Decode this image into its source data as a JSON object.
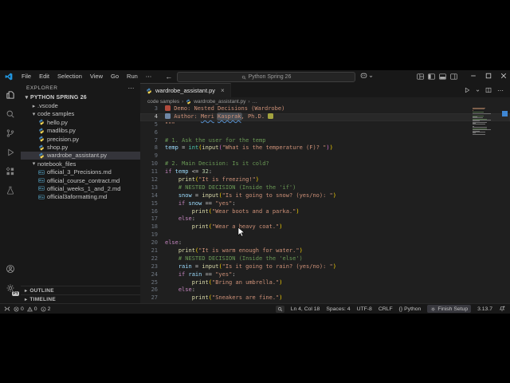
{
  "window": {
    "menus": [
      "File",
      "Edit",
      "Selection",
      "View",
      "Go",
      "Run",
      "⋯"
    ],
    "nav_back": "←",
    "nav_forward": "→",
    "search_text": "Python Spring 26"
  },
  "sidebar": {
    "header": "EXPLORER",
    "header_more": "⋯",
    "tree": [
      {
        "label": "PYTHON SPRING 26",
        "indent": 0,
        "chevron": "down",
        "root": true
      },
      {
        "label": ".vscode",
        "indent": 1,
        "chevron": "right"
      },
      {
        "label": "code samples",
        "indent": 1,
        "chevron": "down"
      },
      {
        "label": "hello.py",
        "indent": 2,
        "type": "py"
      },
      {
        "label": "madlibs.py",
        "indent": 2,
        "type": "py"
      },
      {
        "label": "precision.py",
        "indent": 2,
        "type": "py"
      },
      {
        "label": "shop.py",
        "indent": 2,
        "type": "py"
      },
      {
        "label": "wardrobe_assistant.py",
        "indent": 2,
        "type": "py",
        "selected": true
      },
      {
        "label": "notebook_files",
        "indent": 1,
        "chevron": "down"
      },
      {
        "label": "official_3_Precisions.md",
        "indent": 2,
        "type": "md"
      },
      {
        "label": "official_course_contract.md",
        "indent": 2,
        "type": "md"
      },
      {
        "label": "official_weeks_1_and_2.md",
        "indent": 2,
        "type": "md"
      },
      {
        "label": "official3aformatting.md",
        "indent": 2,
        "type": "md"
      }
    ],
    "sections": [
      {
        "label": "OUTLINE"
      },
      {
        "label": "TIMELINE"
      }
    ],
    "profile_badge": "PY"
  },
  "editor": {
    "tab": {
      "label": "wardrobe_assistant.py",
      "close": "×"
    },
    "breadcrumb": {
      "folder": "code samples",
      "file": "wardrobe_assistant.py",
      "symbol": "…",
      "sep": "›"
    },
    "current_line": 4,
    "lines": [
      {
        "n": 3,
        "seg": [
          [
            "e-coat",
            "🧥"
          ],
          [
            "d",
            " Demo: Nested Decisions (Wardrobe)"
          ]
        ]
      },
      {
        "n": 4,
        "seg": [
          [
            "e-person",
            "👤"
          ],
          [
            "d",
            " Author: "
          ],
          [
            "d sq",
            "Meri"
          ],
          [
            "d",
            " "
          ],
          [
            "d sq hl",
            "Kasprak"
          ],
          [
            "d",
            ", Ph.D. "
          ],
          [
            "e-glove",
            "🧤"
          ]
        ]
      },
      {
        "n": 5,
        "seg": [
          [
            "d",
            "\"\"\""
          ]
        ]
      },
      {
        "n": 6,
        "seg": []
      },
      {
        "n": 7,
        "seg": [
          [
            "c",
            "# 1. Ask the user for the temp"
          ]
        ]
      },
      {
        "n": 8,
        "seg": [
          [
            "v",
            "temp"
          ],
          [
            "o",
            " = "
          ],
          [
            "t",
            "int"
          ],
          [
            "p1",
            "("
          ],
          [
            "f",
            "input"
          ],
          [
            "p2",
            "("
          ],
          [
            "s",
            "\"What is the temperature (F)? \""
          ],
          [
            "p2",
            ")"
          ],
          [
            "p1",
            ")"
          ]
        ]
      },
      {
        "n": 9,
        "seg": []
      },
      {
        "n": 10,
        "seg": [
          [
            "c",
            "# 2. Main Decision: Is it cold?"
          ]
        ]
      },
      {
        "n": 11,
        "seg": [
          [
            "k",
            "if"
          ],
          [
            "o",
            " "
          ],
          [
            "v",
            "temp"
          ],
          [
            "o",
            " <= "
          ],
          [
            "n",
            "32"
          ],
          [
            "o",
            ":"
          ]
        ]
      },
      {
        "n": 12,
        "seg": [
          [
            "o",
            "    "
          ],
          [
            "f",
            "print"
          ],
          [
            "p1",
            "("
          ],
          [
            "s",
            "\"It is freezing!\""
          ],
          [
            "p1",
            ")"
          ]
        ]
      },
      {
        "n": 13,
        "seg": [
          [
            "c",
            "    # NESTED DECISION (Inside the 'if')"
          ]
        ]
      },
      {
        "n": 14,
        "seg": [
          [
            "o",
            "    "
          ],
          [
            "v",
            "snow"
          ],
          [
            "o",
            " = "
          ],
          [
            "f",
            "input"
          ],
          [
            "p1",
            "("
          ],
          [
            "s",
            "\"Is it going to snow? (yes/no): \""
          ],
          [
            "p1",
            ")"
          ]
        ]
      },
      {
        "n": 15,
        "seg": [
          [
            "o",
            "    "
          ],
          [
            "k",
            "if"
          ],
          [
            "o",
            " "
          ],
          [
            "v",
            "snow"
          ],
          [
            "o",
            " == "
          ],
          [
            "s",
            "\"yes\""
          ],
          [
            "o",
            ":"
          ]
        ]
      },
      {
        "n": 16,
        "seg": [
          [
            "o",
            "        "
          ],
          [
            "f",
            "print"
          ],
          [
            "p1",
            "("
          ],
          [
            "s",
            "\"Wear boots and a parka.\""
          ],
          [
            "p1",
            ")"
          ]
        ]
      },
      {
        "n": 17,
        "seg": [
          [
            "o",
            "    "
          ],
          [
            "k",
            "else"
          ],
          [
            "o",
            ":"
          ]
        ]
      },
      {
        "n": 18,
        "seg": [
          [
            "o",
            "        "
          ],
          [
            "f",
            "print"
          ],
          [
            "p1",
            "("
          ],
          [
            "s",
            "\"Wear a heavy coat.\""
          ],
          [
            "p1",
            ")"
          ]
        ]
      },
      {
        "n": 19,
        "seg": []
      },
      {
        "n": 20,
        "seg": [
          [
            "k",
            "else"
          ],
          [
            "o",
            ":"
          ]
        ]
      },
      {
        "n": 21,
        "seg": [
          [
            "o",
            "    "
          ],
          [
            "f",
            "print"
          ],
          [
            "p1",
            "("
          ],
          [
            "s",
            "\"It is warm enough for water.\""
          ],
          [
            "p1",
            ")"
          ]
        ]
      },
      {
        "n": 22,
        "seg": [
          [
            "c",
            "    # NESTED DECISION (Inside the 'else')"
          ]
        ]
      },
      {
        "n": 23,
        "seg": [
          [
            "o",
            "    "
          ],
          [
            "v",
            "rain"
          ],
          [
            "o",
            " = "
          ],
          [
            "f",
            "input"
          ],
          [
            "p1",
            "("
          ],
          [
            "s",
            "\"Is it going to rain? (yes/no): \""
          ],
          [
            "p1",
            ")"
          ]
        ]
      },
      {
        "n": 24,
        "seg": [
          [
            "o",
            "    "
          ],
          [
            "k",
            "if"
          ],
          [
            "o",
            " "
          ],
          [
            "v",
            "rain"
          ],
          [
            "o",
            " == "
          ],
          [
            "s",
            "\"yes\""
          ],
          [
            "o",
            ":"
          ]
        ]
      },
      {
        "n": 25,
        "seg": [
          [
            "o",
            "        "
          ],
          [
            "f",
            "print"
          ],
          [
            "p1",
            "("
          ],
          [
            "s",
            "\"Bring an umbrella.\""
          ],
          [
            "p1",
            ")"
          ]
        ]
      },
      {
        "n": 26,
        "seg": [
          [
            "o",
            "    "
          ],
          [
            "k",
            "else"
          ],
          [
            "o",
            ":"
          ]
        ]
      },
      {
        "n": 27,
        "seg": [
          [
            "o",
            "        "
          ],
          [
            "f",
            "print"
          ],
          [
            "p1",
            "("
          ],
          [
            "s",
            "\"Sneakers are fine.\""
          ],
          [
            "p1",
            ")"
          ]
        ]
      }
    ]
  },
  "status_bar": {
    "errors": "0",
    "warnings": "0",
    "infos": "2",
    "line_col": "Ln 4, Col 18",
    "indent": "Spaces: 4",
    "encoding": "UTF-8",
    "eol": "CRLF",
    "lang_braces": "{}",
    "language": "Python",
    "setup": "Finish Setup",
    "py_version": "3.13.7"
  },
  "colors": {
    "accent": "#0078d4",
    "keyword": "#c586c0",
    "string": "#ce9178",
    "comment": "#6a9955",
    "variable": "#9cdcfe",
    "function": "#dcdcaa",
    "selection_marker": "#3f87d4"
  }
}
